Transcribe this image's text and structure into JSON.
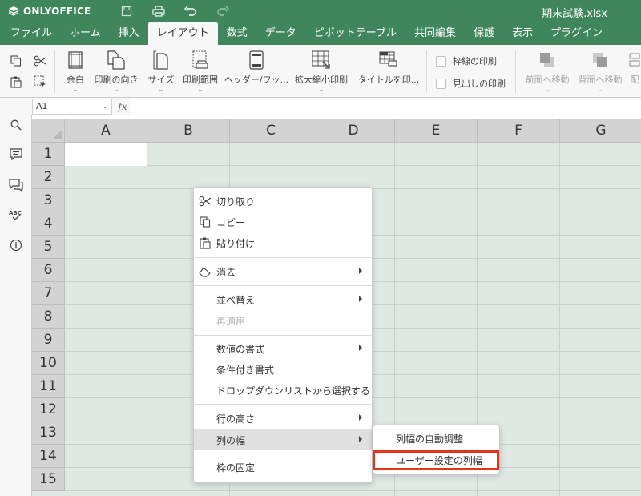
{
  "app": {
    "brand": "ONLYOFFICE",
    "doc_title": "期末試験.xlsx",
    "accent": "#40865c"
  },
  "tabs": [
    "ファイル",
    "ホーム",
    "挿入",
    "レイアウト",
    "数式",
    "データ",
    "ピボットテーブル",
    "共同編集",
    "保護",
    "表示",
    "プラグイン"
  ],
  "active_tab": "レイアウト",
  "toolbar": {
    "margins": "余白",
    "orientation": "印刷の向き",
    "size": "サイズ",
    "print_area": "印刷範囲",
    "header_footer": "ヘッダー/フッ...",
    "scale": "拡大縮小印刷",
    "print_titles": "タイトルを印...",
    "print_gridlines": "枠線の印刷",
    "print_headings": "見出しの印刷",
    "bring_forward": "前面へ移動",
    "send_backward": "背面へ移動",
    "align": "配"
  },
  "formula_bar": {
    "cell_ref": "A1",
    "fx": "fx",
    "value": ""
  },
  "grid": {
    "columns": [
      "A",
      "B",
      "C",
      "D",
      "E",
      "F",
      "G"
    ],
    "rows": [
      "1",
      "2",
      "3",
      "4",
      "5",
      "6",
      "7",
      "8",
      "9",
      "10",
      "11",
      "12",
      "13",
      "14",
      "15"
    ]
  },
  "context_menu": {
    "cut": "切り取り",
    "copy": "コピー",
    "paste": "貼り付け",
    "clear": "消去",
    "sort": "並べ替え",
    "reapply": "再適用",
    "number_format": "数値の書式",
    "conditional_format": "条件付き書式",
    "dropdown_list": "ドロップダウンリストから選択する",
    "row_height": "行の高さ",
    "column_width": "列の幅",
    "freeze_panes": "枠の固定"
  },
  "submenu": {
    "autofit": "列幅の自動調整",
    "custom_width": "ユーザー設定の列幅"
  }
}
